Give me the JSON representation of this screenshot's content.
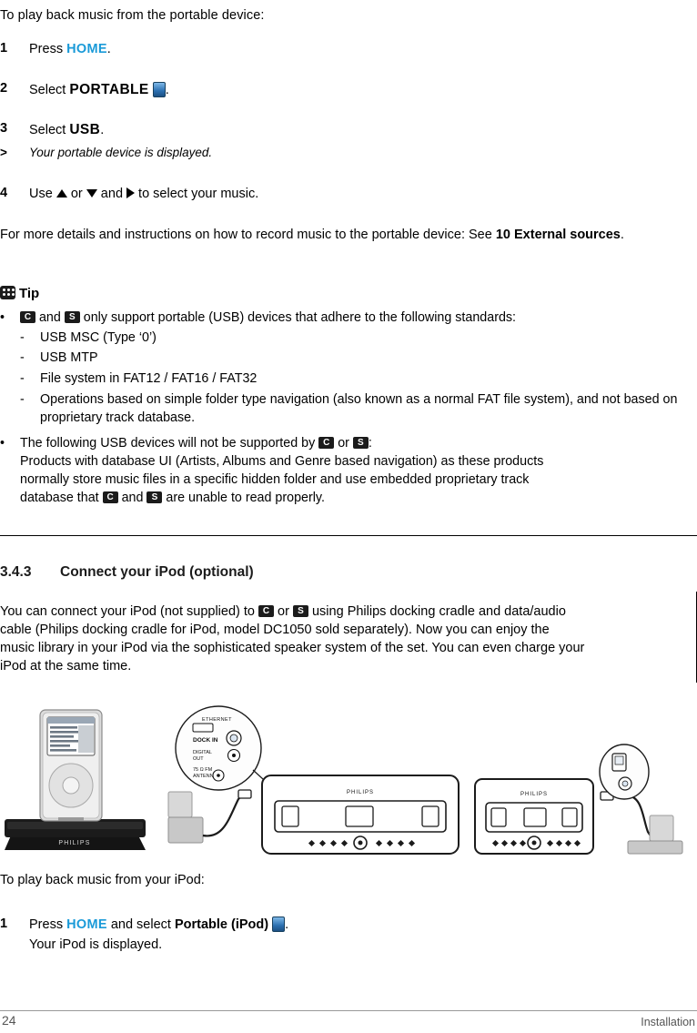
{
  "document": {
    "page_number": "24",
    "footer_label": "Installation"
  },
  "intro": {
    "line": "To play back music from the portable device:"
  },
  "steps": [
    {
      "number": "1",
      "pre": "Press ",
      "keyword": "HOME",
      "post": "."
    },
    {
      "number": "2",
      "pre": "Select ",
      "keyword": "PORTABLE",
      "post": "."
    },
    {
      "number": "3",
      "pre": "Select ",
      "keyword": "USB",
      "post": "."
    },
    {
      "number": "4",
      "pre": "Use ",
      "mid1": " or ",
      "mid2": " and ",
      "post": " to select your music."
    }
  ],
  "note": {
    "marker": ">",
    "text": "Your portable device is displayed."
  },
  "details_paragraph": {
    "part1": "For more details and instructions on how to record music to the portable device: See ",
    "bold": "10 External sources",
    "part2": "."
  },
  "tip": {
    "title": "Tip",
    "bullets": [
      {
        "marker": "•",
        "pre": "",
        "mid": " and ",
        "post": " only support portable (USB) devices that adhere to the following standards:",
        "badge1": "C",
        "badge2": "S",
        "sub_items": [
          "USB MSC (Type ‘0’)",
          "USB MTP",
          "File system in FAT12 / FAT16 / FAT32",
          "Operations based on simple folder type navigation (also known as a normal FAT file system), and not based on proprietary track database."
        ]
      },
      {
        "marker": "•",
        "pre": "The following USB devices will not be supported by ",
        "mid": " or ",
        "post": ":",
        "badge1": "C",
        "badge2": "S",
        "continuation_1": "Products with database UI (Artists, Albums and Genre based navigation) as these products",
        "continuation_2": "normally store music files in a specific hidden folder and use embedded proprietary track",
        "continuation_3a": "database that ",
        "continuation_3b": " and ",
        "continuation_3c": " are unable to read properly."
      }
    ]
  },
  "section": {
    "number": "3.4.3",
    "title": "Connect your iPod (optional)"
  },
  "section_body": {
    "line1a": "You can connect your iPod (not supplied) to ",
    "line1b": " or ",
    "line1c": " using Philips docking cradle and data/audio",
    "line2": "cable (Philips docking cradle for iPod, model DC1050 sold separately). Now you can enjoy the",
    "line3": "music library in your iPod via the sophisticated speaker system of the set. You can even charge your",
    "line4": "iPod at the same time."
  },
  "illustration": {
    "dock_brand": "PHILIPS",
    "center_brand": "PHILIPS",
    "right_brand": "PHILIPS",
    "connector_labels": {
      "ethernet": "ETHERNET",
      "dock_in": "DOCK IN",
      "digital_out": "DIGITAL OUT",
      "fm_antenna": "75 Ω FM ANTENNA"
    }
  },
  "ipod_playback": {
    "heading": "To play back music from your iPod:",
    "step_number": "1",
    "step_pre": "Press ",
    "step_keyword": "HOME",
    "step_mid": " and select ",
    "step_bold": "Portable (iPod)",
    "step_post": ".",
    "step_line2": "Your iPod is displayed."
  }
}
